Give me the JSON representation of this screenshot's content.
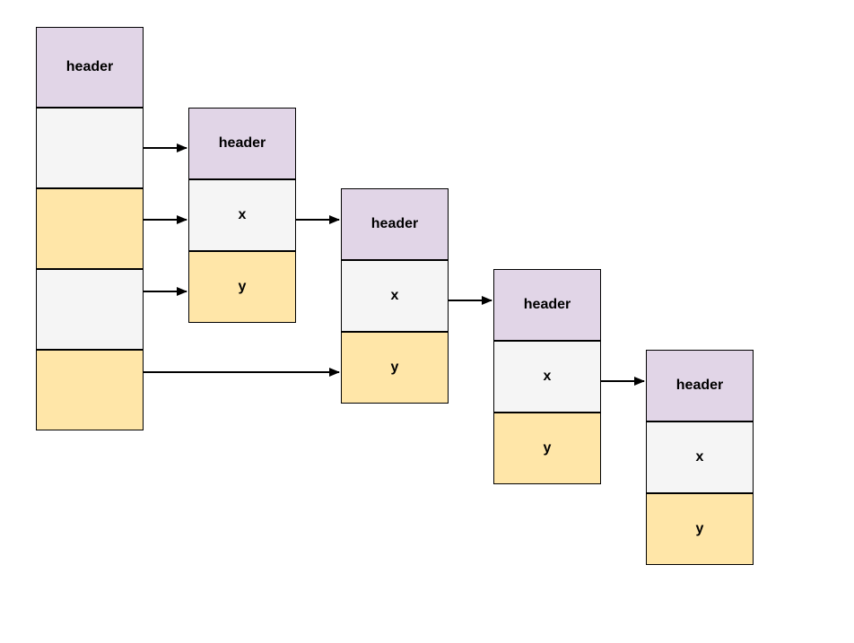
{
  "labels": {
    "header": "header",
    "x": "x",
    "y": "y"
  },
  "colors": {
    "purple": "#e1d5e7",
    "gray": "#f5f5f5",
    "yellow": "#ffe6a8",
    "border": "#000000",
    "arrow": "#000000"
  },
  "diagram": {
    "description": "Linked-list / pointer diagram. Leftmost column is one tall node with a header cell and four slot cells (alternating gray and yellow). Each slot cell's right edge has an arrow pointing to the header (or x) cell of a smaller 3-cell node to its right. Each small node consists of a purple 'header' cell, a gray 'x' cell, and a yellow 'y' cell stacked vertically. The 'x' cell of each small node points to the next small node's header. Four small nodes cascade down-right.",
    "leftColumn": {
      "cells": [
        {
          "role": "header",
          "text_key": "labels.header",
          "color": "purple"
        },
        {
          "role": "slot",
          "text_key": null,
          "color": "gray",
          "arrow_to": "node1.header"
        },
        {
          "role": "slot",
          "text_key": null,
          "color": "yellow",
          "arrow_to": "node1.x"
        },
        {
          "role": "slot",
          "text_key": null,
          "color": "gray",
          "arrow_to": "node1.y"
        },
        {
          "role": "slot",
          "text_key": null,
          "color": "yellow",
          "arrow_to": "node2.y"
        }
      ]
    },
    "nodes": [
      {
        "id": "node1",
        "header_key": "labels.header",
        "x_key": "labels.x",
        "y_key": "labels.y",
        "arrow_from_x_to": "node2.header"
      },
      {
        "id": "node2",
        "header_key": "labels.header",
        "x_key": "labels.x",
        "y_key": "labels.y",
        "arrow_from_x_to": "node3.header"
      },
      {
        "id": "node3",
        "header_key": "labels.header",
        "x_key": "labels.x",
        "y_key": "labels.y",
        "arrow_from_x_to": "node4.header"
      },
      {
        "id": "node4",
        "header_key": "labels.header",
        "x_key": "labels.x",
        "y_key": "labels.y"
      }
    ]
  }
}
